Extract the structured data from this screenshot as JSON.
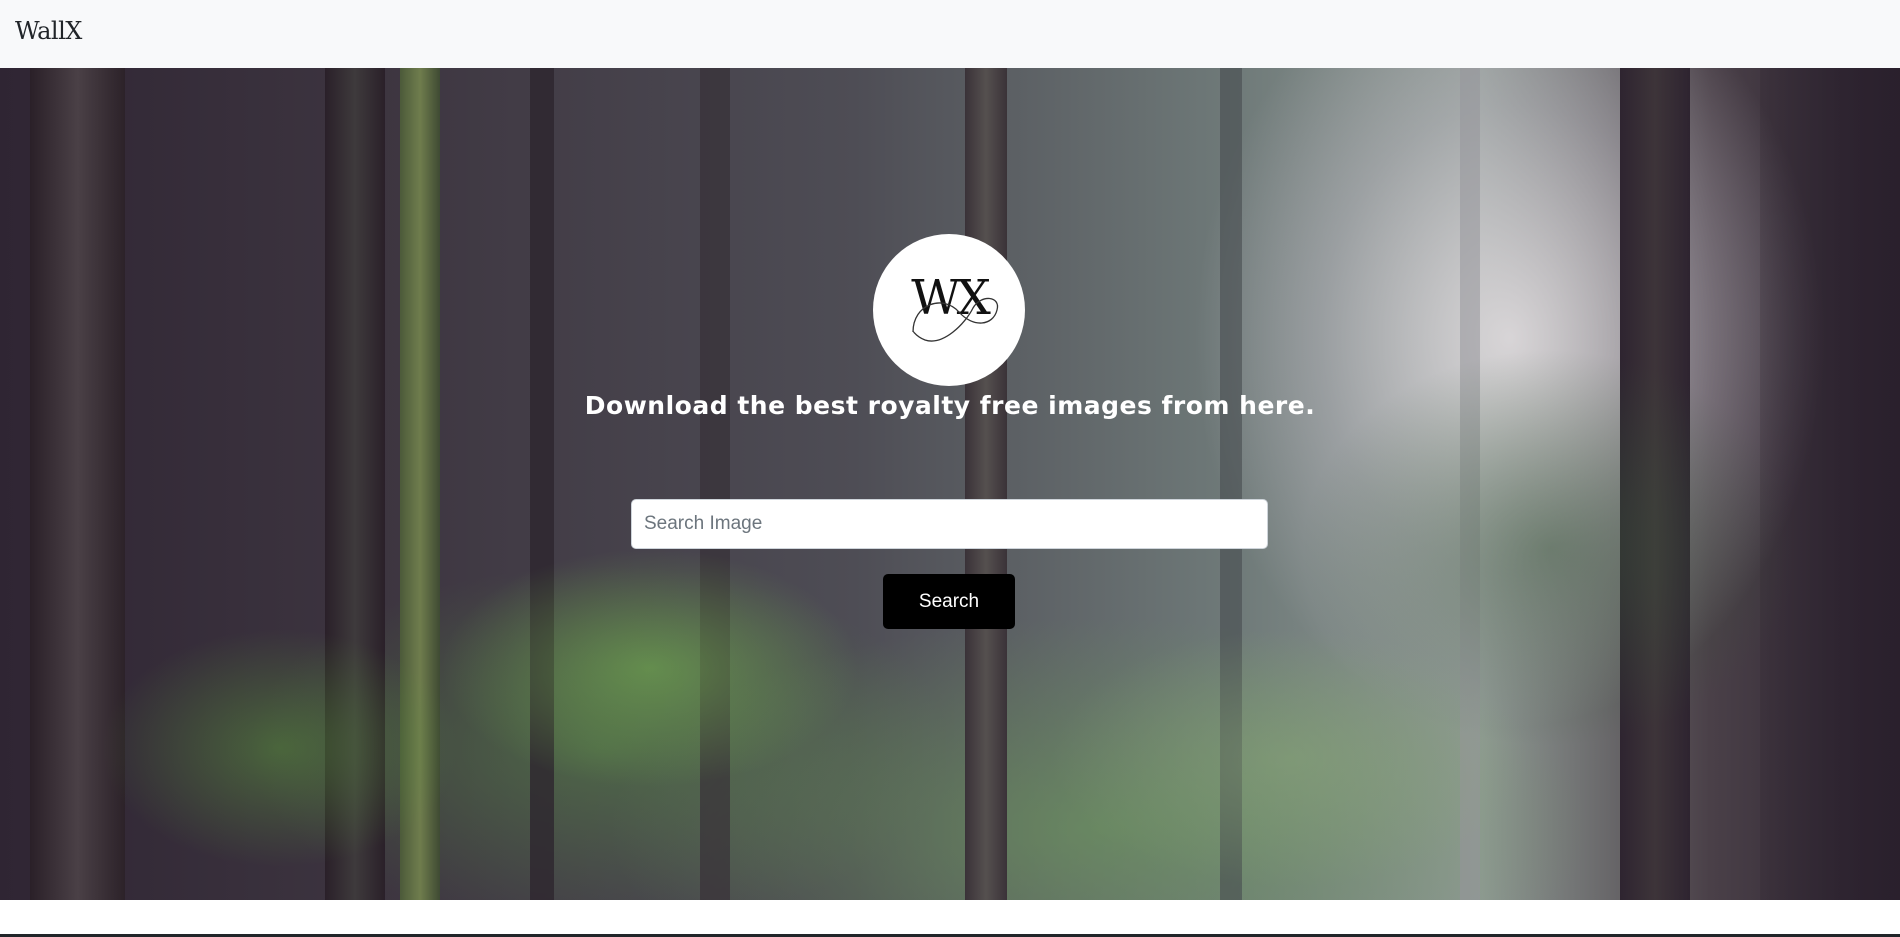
{
  "navbar": {
    "brand": "WallX"
  },
  "hero": {
    "background_image": "forest-photo",
    "logo": {
      "text": "WX",
      "icon": "wallx-monogram-logo"
    },
    "tagline": "Download the best royalty free images from here.",
    "search": {
      "placeholder": "Search Image",
      "value": "",
      "button_label": "Search"
    }
  },
  "colors": {
    "navbar_bg": "#f8f9fa",
    "button_bg": "#000000",
    "button_text": "#ffffff",
    "tagline_text": "#ffffff"
  }
}
